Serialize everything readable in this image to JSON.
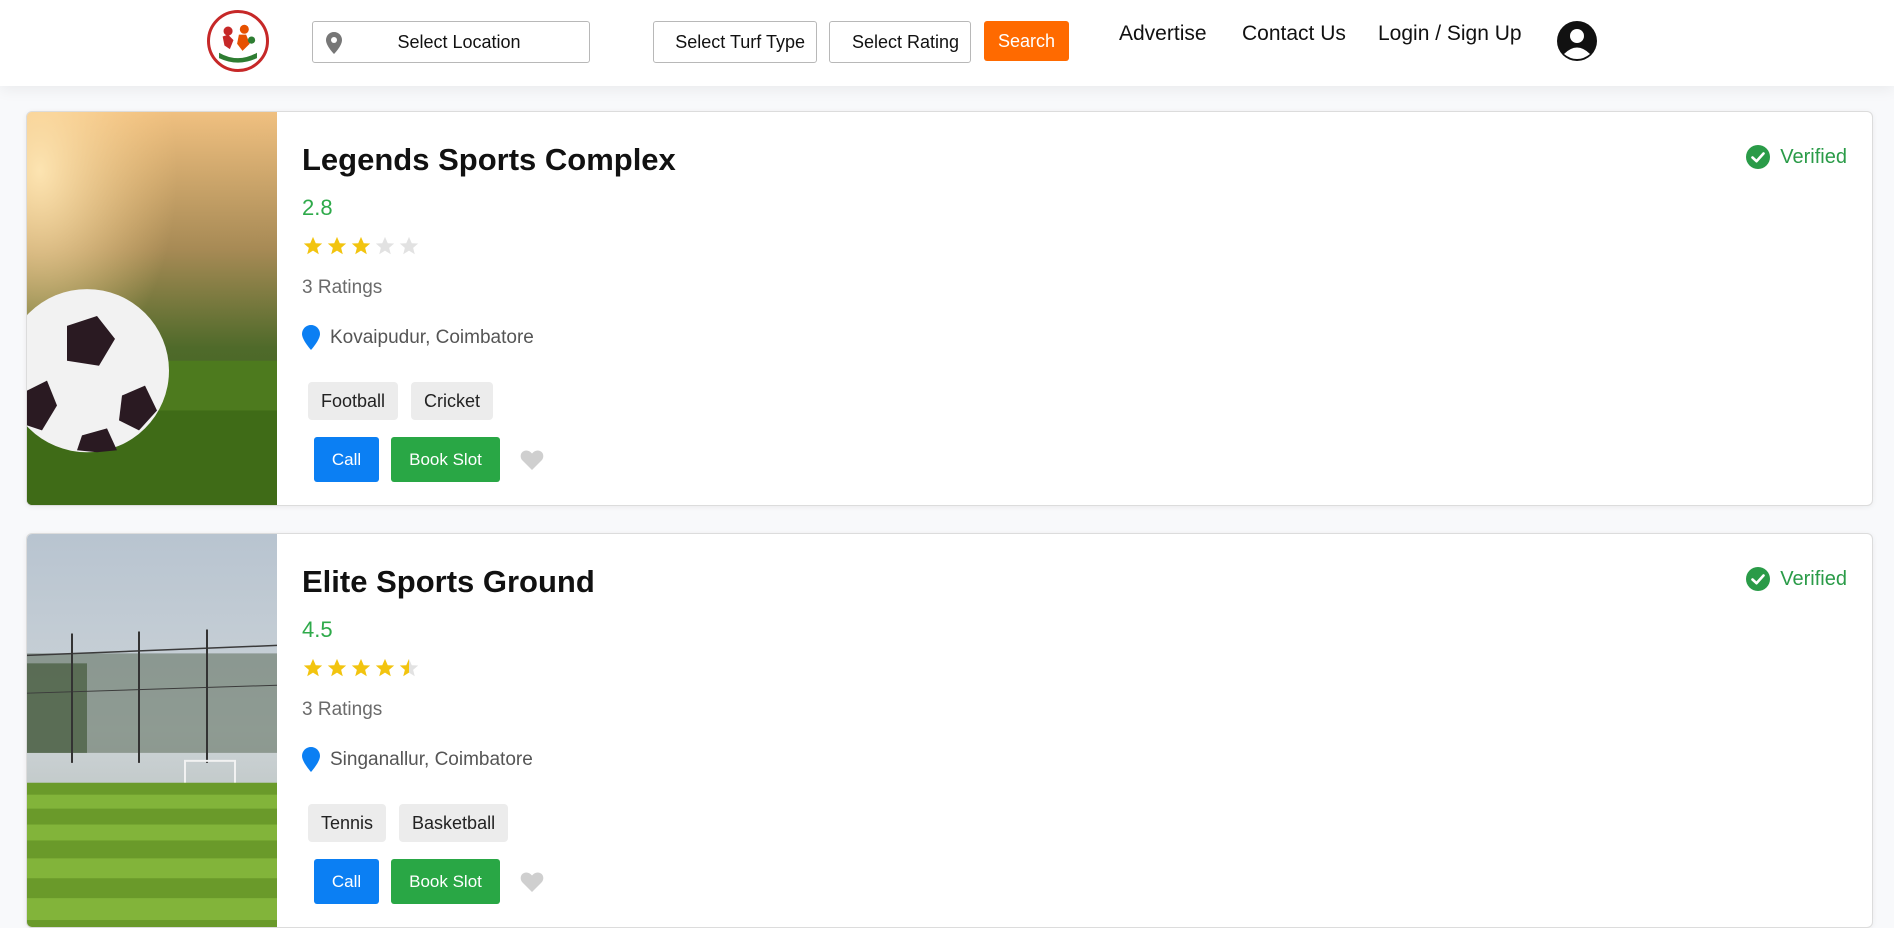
{
  "header": {
    "location_placeholder": "Select Location",
    "turf_type_label": "Select Turf Type",
    "rating_label": "Select Rating",
    "search_label": "Search",
    "nav": {
      "advertise": "Advertise",
      "contact": "Contact Us",
      "login": "Login / Sign Up"
    }
  },
  "colors": {
    "accent_orange": "#ff6a00",
    "call_blue": "#0b7ff3",
    "book_green": "#29a745",
    "verified_green": "#2a9b48",
    "star_gold": "#f2c40f"
  },
  "listings": [
    {
      "name": "Legends Sports Complex",
      "rating": "2.8",
      "stars": 2.8,
      "ratings_count": "3 Ratings",
      "location": "Kovaipudur, Coimbatore",
      "tags": [
        "Football",
        "Cricket"
      ],
      "verified": "Verified",
      "call_label": "Call",
      "book_label": "Book Slot"
    },
    {
      "name": "Elite Sports Ground",
      "rating": "4.5",
      "stars": 4.5,
      "ratings_count": "3 Ratings",
      "location": "Singanallur, Coimbatore",
      "tags": [
        "Tennis",
        "Basketball"
      ],
      "verified": "Verified",
      "call_label": "Call",
      "book_label": "Book Slot"
    }
  ]
}
